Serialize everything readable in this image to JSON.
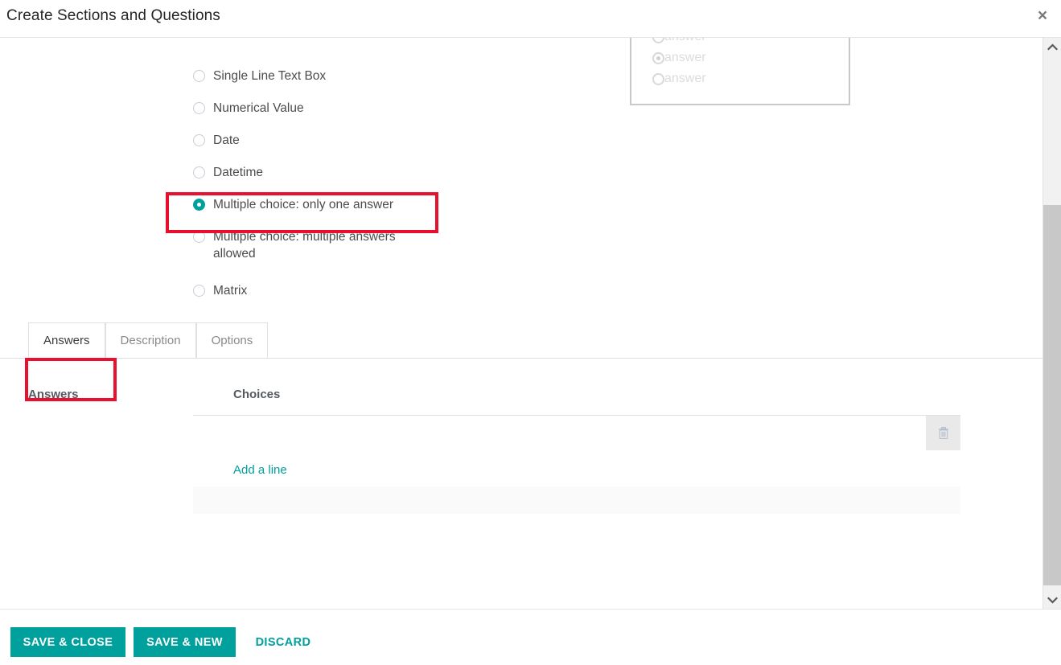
{
  "dialog": {
    "title": "Create Sections and Questions",
    "close_icon": "close-icon",
    "close_label": "×"
  },
  "question_types": {
    "selected": "Multiple choice: only one answer",
    "options": [
      {
        "label": "Single Line Text Box",
        "checked": false
      },
      {
        "label": "Numerical Value",
        "checked": false
      },
      {
        "label": "Date",
        "checked": false
      },
      {
        "label": "Datetime",
        "checked": false
      },
      {
        "label": "Multiple choice: only one answer",
        "checked": true
      },
      {
        "label": "Multiple choice: multiple answers allowed",
        "checked": false
      },
      {
        "label": "Matrix",
        "checked": false
      }
    ]
  },
  "preview": {
    "rows": [
      {
        "label": "answer",
        "checked": false
      },
      {
        "label": "answer",
        "checked": true
      },
      {
        "label": "answer",
        "checked": false
      }
    ]
  },
  "tabs": [
    {
      "label": "Answers",
      "active": true
    },
    {
      "label": "Description",
      "active": false
    },
    {
      "label": "Options",
      "active": false
    }
  ],
  "answers_section": {
    "label": "Answers",
    "table": {
      "columns": [
        "Choices"
      ],
      "rows": [],
      "add_line_label": "Add a line",
      "delete_icon": "trash-icon"
    }
  },
  "footer": {
    "save_close_label": "SAVE & CLOSE",
    "save_new_label": "SAVE & NEW",
    "discard_label": "DISCARD"
  },
  "scrollbar": {
    "up_icon": "chevron-up-icon",
    "down_icon": "chevron-down-icon"
  },
  "colors": {
    "accent": "#00a09d",
    "highlight": "#e8112d",
    "text": "#4c4c4c"
  }
}
